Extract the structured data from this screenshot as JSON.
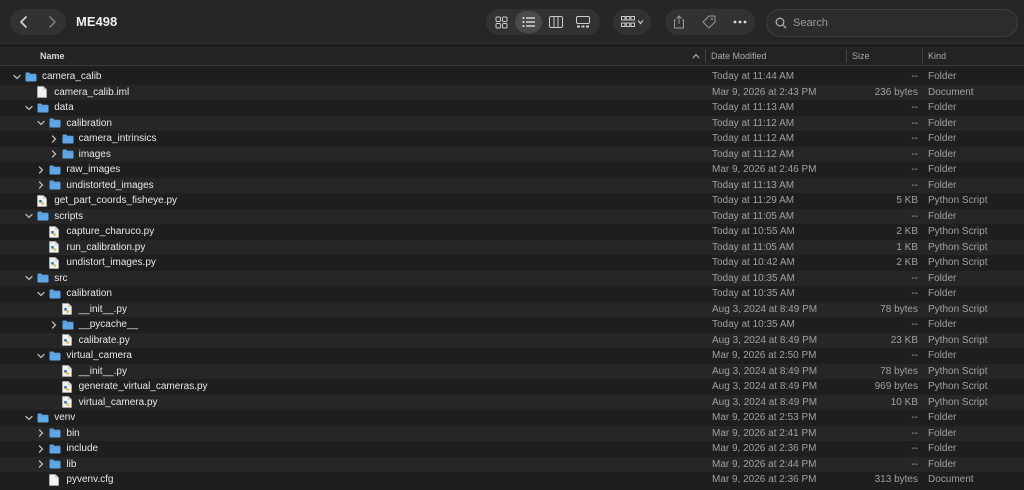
{
  "window": {
    "title": "ME498"
  },
  "search": {
    "placeholder": "Search"
  },
  "columns": {
    "name": "Name",
    "date": "Date Modified",
    "size": "Size",
    "kind": "Kind"
  },
  "colors": {
    "folder": "#5fa8e8",
    "background": "#1e1e1e",
    "alt_row": "#262626"
  },
  "toolbar_icons": [
    "back-icon",
    "forward-icon",
    "icon-view-icon",
    "list-view-icon",
    "column-view-icon",
    "gallery-view-icon",
    "group-icon",
    "share-icon",
    "tag-icon",
    "more-icon",
    "search-icon"
  ],
  "rows": [
    {
      "name": "camera_calib",
      "depth": 0,
      "type": "folder",
      "disclosure": "open",
      "date": "Today at 11:44 AM",
      "size": "--",
      "kind": "Folder"
    },
    {
      "name": "camera_calib.iml",
      "depth": 1,
      "type": "doc",
      "disclosure": "none",
      "date": "Mar 9, 2026 at 2:43 PM",
      "size": "236 bytes",
      "kind": "Document"
    },
    {
      "name": "data",
      "depth": 1,
      "type": "folder",
      "disclosure": "open",
      "date": "Today at 11:13 AM",
      "size": "--",
      "kind": "Folder"
    },
    {
      "name": "calibration",
      "depth": 2,
      "type": "folder",
      "disclosure": "open",
      "date": "Today at 11:12 AM",
      "size": "--",
      "kind": "Folder"
    },
    {
      "name": "camera_intrinsics",
      "depth": 3,
      "type": "folder",
      "disclosure": "closed",
      "date": "Today at 11:12 AM",
      "size": "--",
      "kind": "Folder"
    },
    {
      "name": "images",
      "depth": 3,
      "type": "folder",
      "disclosure": "closed",
      "date": "Today at 11:12 AM",
      "size": "--",
      "kind": "Folder"
    },
    {
      "name": "raw_images",
      "depth": 2,
      "type": "folder",
      "disclosure": "closed",
      "date": "Mar 9, 2026 at 2:46 PM",
      "size": "--",
      "kind": "Folder"
    },
    {
      "name": "undistorted_images",
      "depth": 2,
      "type": "folder",
      "disclosure": "closed",
      "date": "Today at 11:13 AM",
      "size": "--",
      "kind": "Folder"
    },
    {
      "name": "get_part_coords_fisheye.py",
      "depth": 1,
      "type": "py",
      "disclosure": "none",
      "date": "Today at 11:29 AM",
      "size": "5 KB",
      "kind": "Python Script"
    },
    {
      "name": "scripts",
      "depth": 1,
      "type": "folder",
      "disclosure": "open",
      "date": "Today at 11:05 AM",
      "size": "--",
      "kind": "Folder"
    },
    {
      "name": "capture_charuco.py",
      "depth": 2,
      "type": "py",
      "disclosure": "none",
      "date": "Today at 10:55 AM",
      "size": "2 KB",
      "kind": "Python Script"
    },
    {
      "name": "run_calibration.py",
      "depth": 2,
      "type": "py",
      "disclosure": "none",
      "date": "Today at 11:05 AM",
      "size": "1 KB",
      "kind": "Python Script"
    },
    {
      "name": "undistort_images.py",
      "depth": 2,
      "type": "py",
      "disclosure": "none",
      "date": "Today at 10:42 AM",
      "size": "2 KB",
      "kind": "Python Script"
    },
    {
      "name": "src",
      "depth": 1,
      "type": "folder",
      "disclosure": "open",
      "date": "Today at 10:35 AM",
      "size": "--",
      "kind": "Folder"
    },
    {
      "name": "calibration",
      "depth": 2,
      "type": "folder",
      "disclosure": "open",
      "date": "Today at 10:35 AM",
      "size": "--",
      "kind": "Folder"
    },
    {
      "name": "__init__.py",
      "depth": 3,
      "type": "py",
      "disclosure": "none",
      "date": "Aug 3, 2024 at 8:49 PM",
      "size": "78 bytes",
      "kind": "Python Script"
    },
    {
      "name": "__pycache__",
      "depth": 3,
      "type": "folder",
      "disclosure": "closed",
      "date": "Today at 10:35 AM",
      "size": "--",
      "kind": "Folder"
    },
    {
      "name": "calibrate.py",
      "depth": 3,
      "type": "py",
      "disclosure": "none",
      "date": "Aug 3, 2024 at 8:49 PM",
      "size": "23 KB",
      "kind": "Python Script"
    },
    {
      "name": "virtual_camera",
      "depth": 2,
      "type": "folder",
      "disclosure": "open",
      "date": "Mar 9, 2026 at 2:50 PM",
      "size": "--",
      "kind": "Folder"
    },
    {
      "name": "__init__.py",
      "depth": 3,
      "type": "py",
      "disclosure": "none",
      "date": "Aug 3, 2024 at 8:49 PM",
      "size": "78 bytes",
      "kind": "Python Script"
    },
    {
      "name": "generate_virtual_cameras.py",
      "depth": 3,
      "type": "py",
      "disclosure": "none",
      "date": "Aug 3, 2024 at 8:49 PM",
      "size": "969 bytes",
      "kind": "Python Script"
    },
    {
      "name": "virtual_camera.py",
      "depth": 3,
      "type": "py",
      "disclosure": "none",
      "date": "Aug 3, 2024 at 8:49 PM",
      "size": "10 KB",
      "kind": "Python Script"
    },
    {
      "name": "venv",
      "depth": 1,
      "type": "folder",
      "disclosure": "open",
      "date": "Mar 9, 2026 at 2:53 PM",
      "size": "--",
      "kind": "Folder"
    },
    {
      "name": "bin",
      "depth": 2,
      "type": "folder",
      "disclosure": "closed",
      "date": "Mar 9, 2026 at 2:41 PM",
      "size": "--",
      "kind": "Folder"
    },
    {
      "name": "include",
      "depth": 2,
      "type": "folder",
      "disclosure": "closed",
      "date": "Mar 9, 2026 at 2:36 PM",
      "size": "--",
      "kind": "Folder"
    },
    {
      "name": "lib",
      "depth": 2,
      "type": "folder",
      "disclosure": "closed",
      "date": "Mar 9, 2026 at 2:44 PM",
      "size": "--",
      "kind": "Folder"
    },
    {
      "name": "pyvenv.cfg",
      "depth": 2,
      "type": "doc",
      "disclosure": "none",
      "date": "Mar 9, 2026 at 2:36 PM",
      "size": "313 bytes",
      "kind": "Document"
    }
  ]
}
